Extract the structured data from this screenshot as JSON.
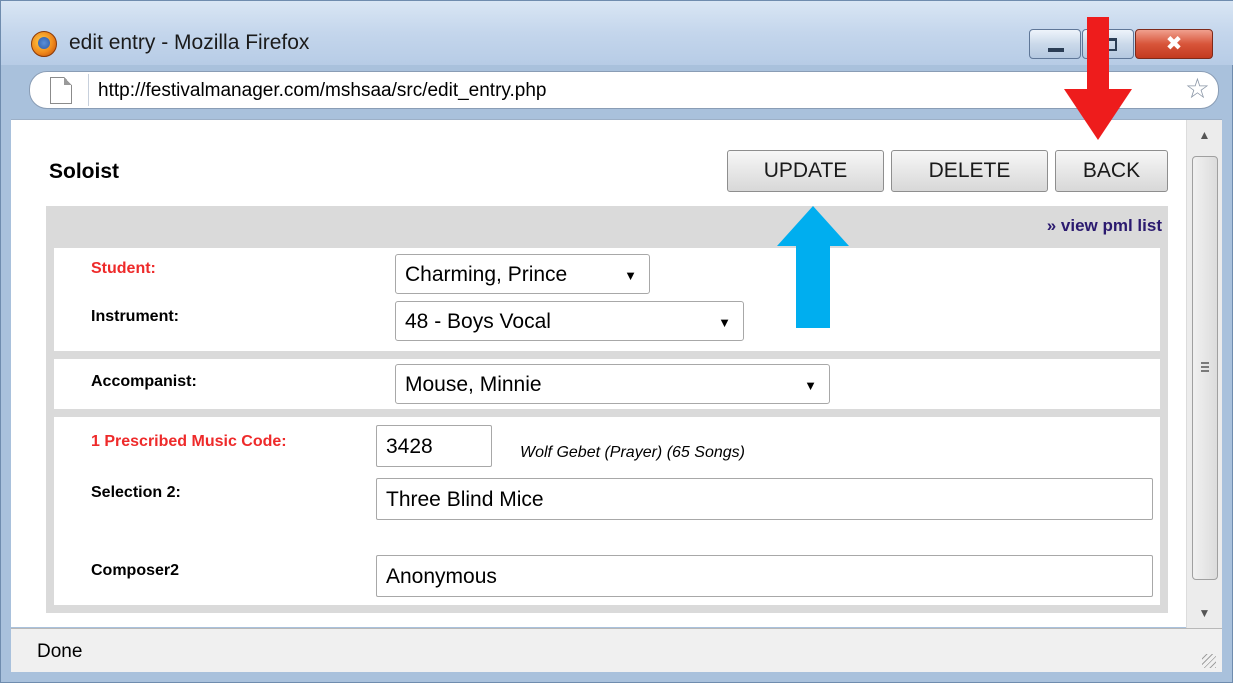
{
  "window": {
    "title": "edit entry - Mozilla Firefox",
    "close_glyph": "✖"
  },
  "urlbar": {
    "url": "http://festivalmanager.com/mshsaa/src/edit_entry.php",
    "star_glyph": "☆"
  },
  "page": {
    "title": "Soloist",
    "buttons": {
      "update": "UPDATE",
      "delete": "DELETE",
      "back": "BACK"
    },
    "pml_link": "» view pml list"
  },
  "form": {
    "student": {
      "label": "Student:",
      "value": "Charming, Prince"
    },
    "instrument": {
      "label": "Instrument:",
      "value": "48 - Boys Vocal"
    },
    "accompanist": {
      "label": "Accompanist:",
      "value": "Mouse, Minnie"
    },
    "music_code": {
      "label": "1 Prescribed Music Code:",
      "value": "3428",
      "title": "Wolf Gebet (Prayer) (65 Songs)"
    },
    "selection2": {
      "label": "Selection 2:",
      "value": "Three Blind Mice"
    },
    "composer2": {
      "label": "Composer2",
      "value": "Anonymous"
    }
  },
  "status": {
    "text": "Done"
  },
  "colors": {
    "required_label": "#ee2a2a",
    "link": "#2b1a6f",
    "arrow_red": "#ee1c1c",
    "arrow_blue": "#00aeef"
  },
  "icons": {
    "app": "firefox-icon",
    "page": "page-icon",
    "dropdown": "chevron-down-icon",
    "bookmark": "star-icon"
  }
}
